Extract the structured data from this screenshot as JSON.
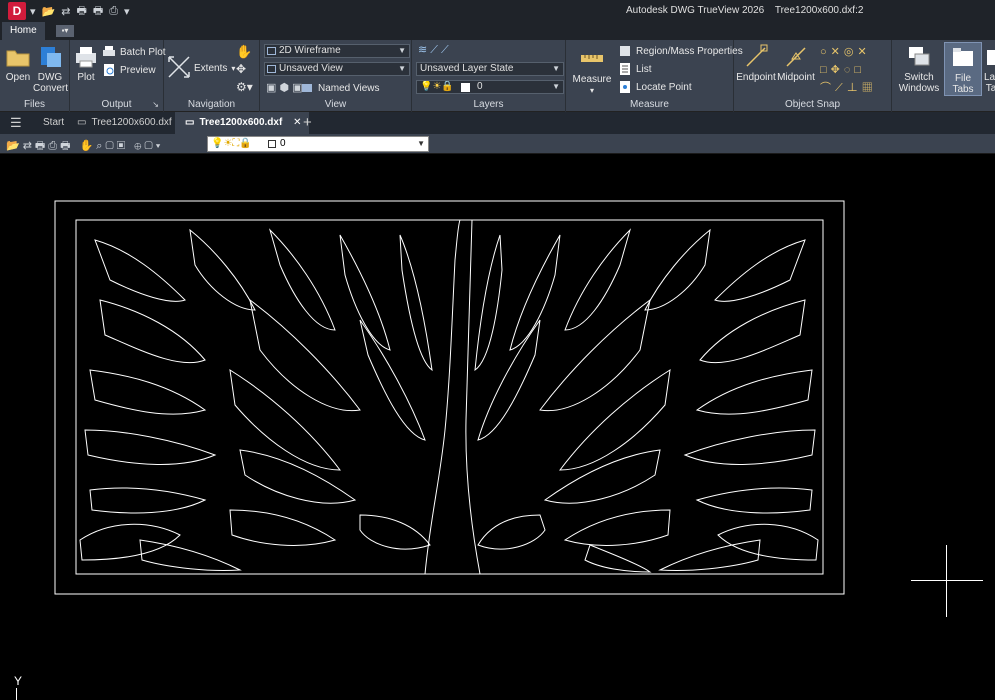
{
  "title": {
    "app": "Autodesk DWG TrueView 2026",
    "file": "Tree1200x600.dxf:2"
  },
  "ribbon_tabs": {
    "home": "Home"
  },
  "panels": {
    "files": {
      "title": "Files",
      "open": "Open",
      "convert_line1": "DWG",
      "convert_line2": "Convert"
    },
    "output": {
      "title": "Output",
      "plot": "Plot",
      "batch_plot": "Batch Plot",
      "preview": "Preview"
    },
    "navigation": {
      "title": "Navigation",
      "extents": "Extents"
    },
    "view": {
      "title": "View",
      "visual_style": "2D Wireframe",
      "saved_view": "Unsaved View",
      "named_views": "Named Views"
    },
    "layers": {
      "title": "Layers",
      "layer_state": "Unsaved Layer State",
      "current_layer": "0"
    },
    "measure": {
      "title": "Measure",
      "measure": "Measure",
      "region_mass": "Region/Mass Properties",
      "list": "List",
      "locate_point": "Locate Point"
    },
    "object_snap": {
      "title": "Object Snap",
      "endpoint": "Endpoint",
      "midpoint": "Midpoint"
    },
    "windows": {
      "switch_line1": "Switch",
      "switch_line2": "Windows",
      "file_tabs": "File Tabs",
      "layout_line1": "Lay",
      "layout_line2": "Ta"
    }
  },
  "doc_tabs": [
    {
      "label": "Start"
    },
    {
      "label": "Tree1200x600.dxf"
    },
    {
      "label": "Tree1200x600.dxf"
    }
  ],
  "view_toolbar": {
    "layer_value": "0"
  },
  "canvas": {
    "ucs_label": "Y"
  },
  "colors": {
    "background": "#000000",
    "ribbon": "#3b4350",
    "titlebar": "#1f2329",
    "accent": "#d11c3c",
    "lines": "#ffffff"
  }
}
